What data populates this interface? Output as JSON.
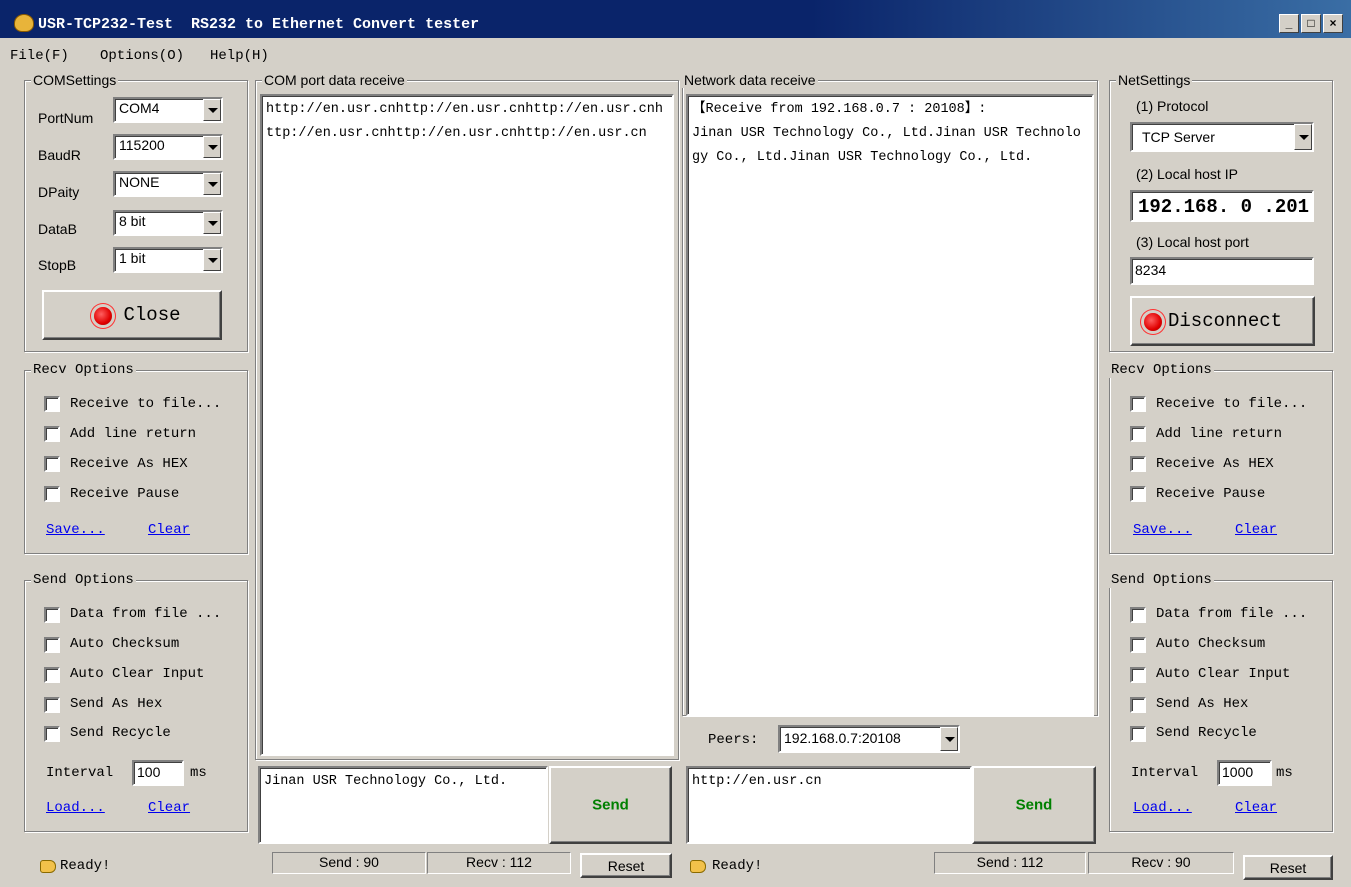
{
  "window": {
    "title": "USR-TCP232-Test  RS232 to Ethernet Convert tester",
    "icon": "app-icon",
    "controls": [
      "_",
      "□",
      "×"
    ]
  },
  "menu": [
    "File(F)",
    "Options(O)",
    "Help(H)"
  ],
  "com_settings": {
    "group_label": "COMSettings",
    "fields": [
      {
        "label": "PortNum",
        "value": "COM4"
      },
      {
        "label": "BaudR",
        "value": "115200"
      },
      {
        "label": "DPaity",
        "value": "NONE"
      },
      {
        "label": "DataB",
        "value": "8 bit"
      },
      {
        "label": "StopB",
        "value": "1 bit"
      }
    ],
    "button": "Close"
  },
  "left_recv_options": {
    "group_label": "Recv Options",
    "checkboxes": [
      "Receive to file...",
      "Add line return",
      "Receive As HEX",
      "Receive Pause"
    ],
    "save": "Save...",
    "clear": "Clear"
  },
  "left_send_options": {
    "group_label": "Send Options",
    "checkboxes": [
      "Data from file ...",
      "Auto Checksum",
      "Auto Clear Input",
      "Send As Hex",
      "Send Recycle"
    ],
    "interval_label": "Interval",
    "interval_value": "100",
    "interval_unit": "ms",
    "load": "Load...",
    "clear": "Clear"
  },
  "com_receive": {
    "group_label": "COM port data receive",
    "text": "http://en.usr.cnhttp://en.usr.cnhttp://en.usr.cnhttp://en.usr.cnhttp://en.usr.cnhttp://en.usr.cn"
  },
  "com_send": {
    "input": "Jinan USR Technology Co., Ltd.",
    "button": "Send"
  },
  "com_status": {
    "ready": "Ready!",
    "send": "Send : 90",
    "recv": "Recv : 112",
    "reset": "Reset"
  },
  "net_receive": {
    "group_label": "Network data receive",
    "header": "【Receive from 192.168.0.7 : 20108】:",
    "text": "Jinan USR Technology Co., Ltd.Jinan USR Technology Co., Ltd.Jinan USR Technology Co., Ltd."
  },
  "peers": {
    "label": "Peers:",
    "value": "192.168.0.7:20108"
  },
  "net_send": {
    "input": "http://en.usr.cn",
    "button": "Send"
  },
  "net_status": {
    "ready": "Ready!",
    "send": "Send : 112",
    "recv": "Recv : 90",
    "reset": "Reset"
  },
  "net_settings": {
    "group_label": "NetSettings",
    "protocol_label": "(1) Protocol",
    "protocol_value": "TCP Server",
    "ip_label": "(2) Local host IP",
    "ip_value": "192.168. 0 .201",
    "port_label": "(3) Local host port",
    "port_value": "8234",
    "button": "Disconnect"
  },
  "right_recv_options": {
    "group_label": "Recv Options",
    "checkboxes": [
      "Receive to file...",
      "Add line return",
      "Receive As HEX",
      "Receive Pause"
    ],
    "save": "Save...",
    "clear": "Clear"
  },
  "right_send_options": {
    "group_label": "Send Options",
    "checkboxes": [
      "Data from file ...",
      "Auto Checksum",
      "Auto Clear Input",
      "Send As Hex",
      "Send Recycle"
    ],
    "interval_label": "Interval",
    "interval_value": "1000",
    "interval_unit": "ms",
    "load": "Load...",
    "clear": "Clear"
  },
  "colors": {
    "titlebar": "#0a246a",
    "face": "#d4d0c8",
    "send_text": "#008000",
    "link": "#0000ee",
    "led": "#e00000"
  }
}
